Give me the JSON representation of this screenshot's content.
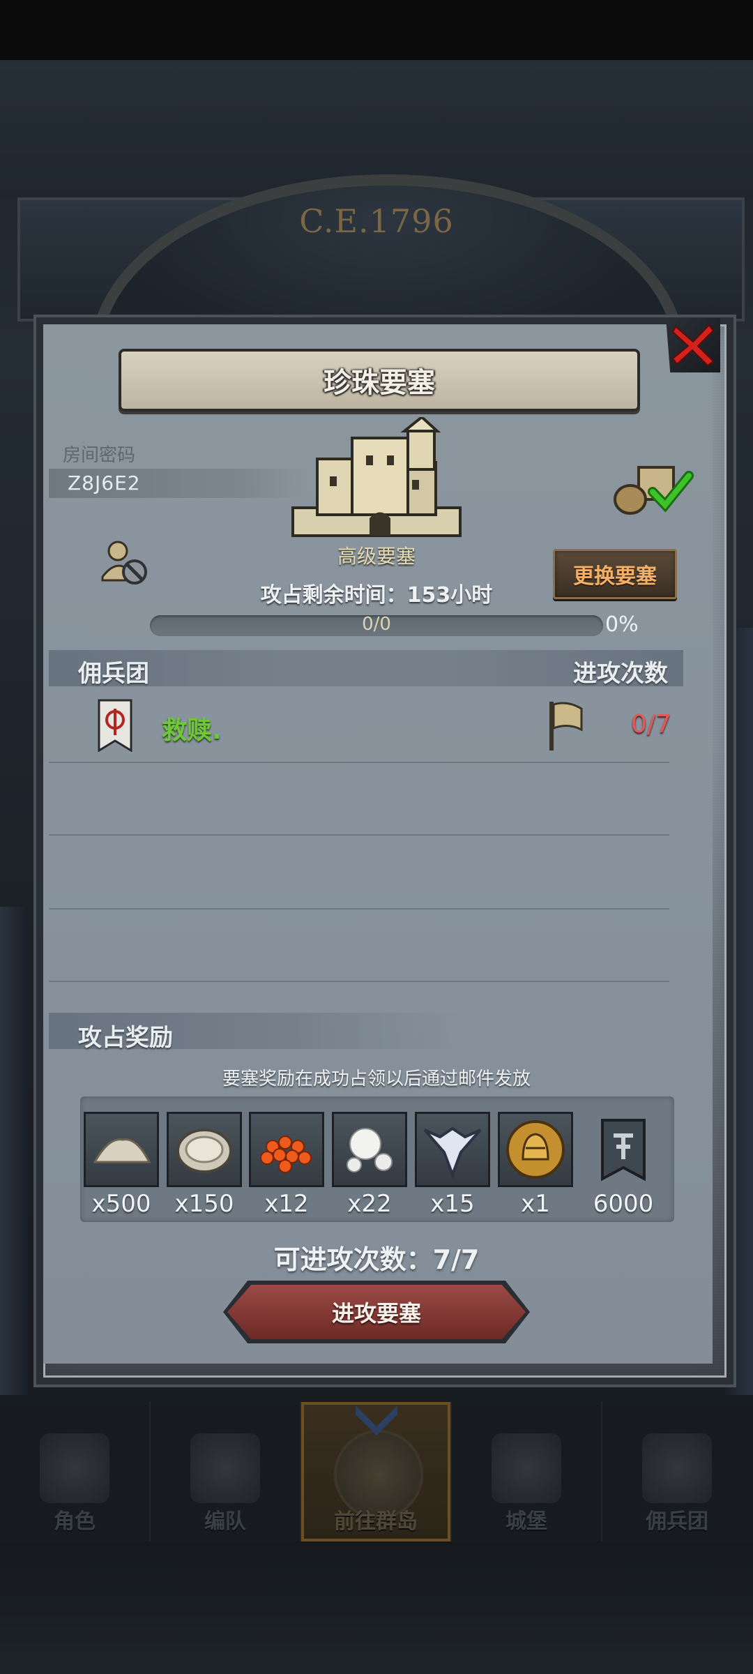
{
  "background": {
    "era_label": "C.E.1796"
  },
  "dialog": {
    "title": "珍珠要塞",
    "room_code_label": "房间密码",
    "room_code": "Z8J6E2",
    "fortress_type": "高级要塞",
    "change_fortress_label": "更换要塞",
    "time_remaining": "攻占剩余时间：153小时",
    "progress": {
      "count": "0/0",
      "percent": "0%",
      "fraction": 0
    },
    "mercenary_header": "佣兵团",
    "attack_count_header": "进攻次数",
    "mercenaries": [
      {
        "name": "救赎.",
        "attacks": "0/7"
      }
    ],
    "reward_header": "攻占奖励",
    "reward_note": "要塞奖励在成功占领以后通过邮件发放",
    "rewards": [
      {
        "icon": "sand-pile-icon",
        "qty": "x500"
      },
      {
        "icon": "oyster-icon",
        "qty": "x150"
      },
      {
        "icon": "fish-roe-icon",
        "qty": "x12"
      },
      {
        "icon": "pearls-icon",
        "qty": "x22"
      },
      {
        "icon": "crest-emblem-icon",
        "qty": "x15"
      },
      {
        "icon": "golden-helmet-coin-icon",
        "qty": "x1"
      },
      {
        "icon": "guild-banner-icon",
        "qty": "6000"
      }
    ],
    "attacks_left": "可进攻次数：7/7",
    "attack_button_label": "进攻要塞"
  },
  "bottom_nav": {
    "tabs": [
      {
        "label": "角色",
        "icon": "knight-icon"
      },
      {
        "label": "编队",
        "icon": "helmet-icon"
      },
      {
        "label": "前往群岛",
        "icon": "globe-icon",
        "active": true
      },
      {
        "label": "城堡",
        "icon": "castle-icon"
      },
      {
        "label": "佣兵团",
        "icon": "mercenary-icon"
      }
    ]
  },
  "colors": {
    "accent_gold": "#f3b064",
    "merc_name_green": "#6fc83a",
    "attack_count_red": "#e05a58",
    "attack_button_red": "#8a3b36"
  }
}
